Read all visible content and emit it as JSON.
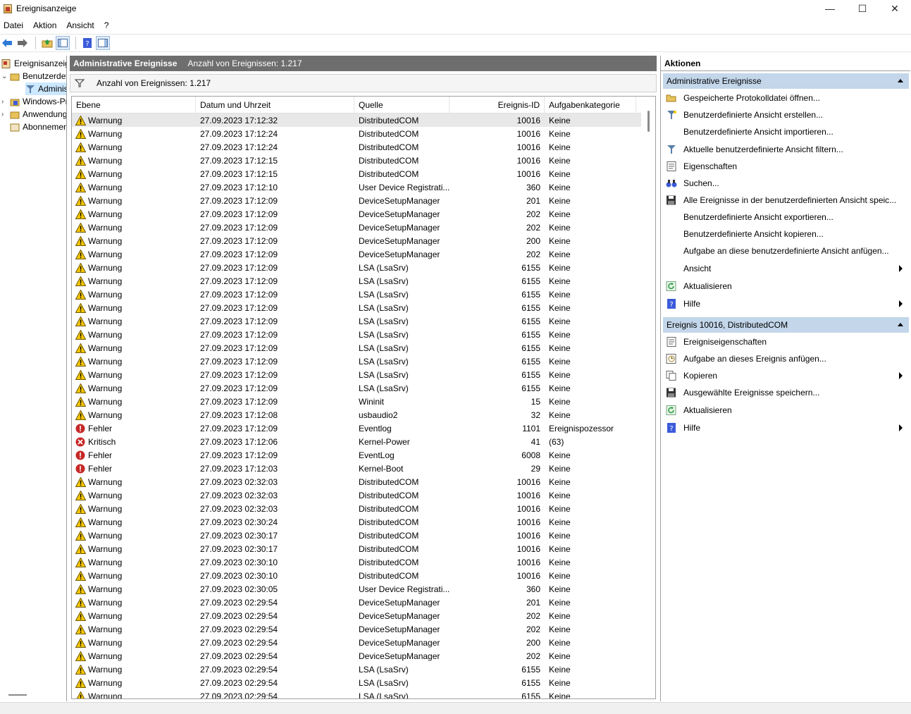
{
  "window": {
    "title": "Ereignisanzeige",
    "minimize_glyph": "—",
    "maximize_glyph": "☐",
    "close_glyph": "✕"
  },
  "menu": [
    "Datei",
    "Aktion",
    "Ansicht",
    "?"
  ],
  "tree": {
    "root": "Ereignisanzeige (Lokal)",
    "custom_views": "Benutzerdefinierte Ansichten",
    "admin_events": "Administrative Ereignisse",
    "windows_logs": "Windows-Protokolle",
    "app_logs": "Anwendungs- und Dienstprotokolle",
    "subscriptions": "Abonnements"
  },
  "center": {
    "header_title": "Administrative Ereignisse",
    "header_count": "Anzahl von Ereignissen: 1.217",
    "filter_text": "Anzahl von Ereignissen: 1.217",
    "columns": [
      "Ebene",
      "Datum und Uhrzeit",
      "Quelle",
      "Ereignis-ID",
      "Aufgabenkategorie"
    ],
    "rows": [
      [
        "Warnung",
        "27.09.2023 17:12:32",
        "DistributedCOM",
        "10016",
        "Keine"
      ],
      [
        "Warnung",
        "27.09.2023 17:12:24",
        "DistributedCOM",
        "10016",
        "Keine"
      ],
      [
        "Warnung",
        "27.09.2023 17:12:24",
        "DistributedCOM",
        "10016",
        "Keine"
      ],
      [
        "Warnung",
        "27.09.2023 17:12:15",
        "DistributedCOM",
        "10016",
        "Keine"
      ],
      [
        "Warnung",
        "27.09.2023 17:12:15",
        "DistributedCOM",
        "10016",
        "Keine"
      ],
      [
        "Warnung",
        "27.09.2023 17:12:10",
        "User Device Registrati...",
        "360",
        "Keine"
      ],
      [
        "Warnung",
        "27.09.2023 17:12:09",
        "DeviceSetupManager",
        "201",
        "Keine"
      ],
      [
        "Warnung",
        "27.09.2023 17:12:09",
        "DeviceSetupManager",
        "202",
        "Keine"
      ],
      [
        "Warnung",
        "27.09.2023 17:12:09",
        "DeviceSetupManager",
        "202",
        "Keine"
      ],
      [
        "Warnung",
        "27.09.2023 17:12:09",
        "DeviceSetupManager",
        "200",
        "Keine"
      ],
      [
        "Warnung",
        "27.09.2023 17:12:09",
        "DeviceSetupManager",
        "202",
        "Keine"
      ],
      [
        "Warnung",
        "27.09.2023 17:12:09",
        "LSA (LsaSrv)",
        "6155",
        "Keine"
      ],
      [
        "Warnung",
        "27.09.2023 17:12:09",
        "LSA (LsaSrv)",
        "6155",
        "Keine"
      ],
      [
        "Warnung",
        "27.09.2023 17:12:09",
        "LSA (LsaSrv)",
        "6155",
        "Keine"
      ],
      [
        "Warnung",
        "27.09.2023 17:12:09",
        "LSA (LsaSrv)",
        "6155",
        "Keine"
      ],
      [
        "Warnung",
        "27.09.2023 17:12:09",
        "LSA (LsaSrv)",
        "6155",
        "Keine"
      ],
      [
        "Warnung",
        "27.09.2023 17:12:09",
        "LSA (LsaSrv)",
        "6155",
        "Keine"
      ],
      [
        "Warnung",
        "27.09.2023 17:12:09",
        "LSA (LsaSrv)",
        "6155",
        "Keine"
      ],
      [
        "Warnung",
        "27.09.2023 17:12:09",
        "LSA (LsaSrv)",
        "6155",
        "Keine"
      ],
      [
        "Warnung",
        "27.09.2023 17:12:09",
        "LSA (LsaSrv)",
        "6155",
        "Keine"
      ],
      [
        "Warnung",
        "27.09.2023 17:12:09",
        "LSA (LsaSrv)",
        "6155",
        "Keine"
      ],
      [
        "Warnung",
        "27.09.2023 17:12:09",
        "Wininit",
        "15",
        "Keine"
      ],
      [
        "Warnung",
        "27.09.2023 17:12:08",
        "usbaudio2",
        "32",
        "Keine"
      ],
      [
        "Fehler",
        "27.09.2023 17:12:09",
        "Eventlog",
        "1101",
        "Ereignispozessor"
      ],
      [
        "Kritisch",
        "27.09.2023 17:12:06",
        "Kernel-Power",
        "41",
        "(63)"
      ],
      [
        "Fehler",
        "27.09.2023 17:12:09",
        "EventLog",
        "6008",
        "Keine"
      ],
      [
        "Fehler",
        "27.09.2023 17:12:03",
        "Kernel-Boot",
        "29",
        "Keine"
      ],
      [
        "Warnung",
        "27.09.2023 02:32:03",
        "DistributedCOM",
        "10016",
        "Keine"
      ],
      [
        "Warnung",
        "27.09.2023 02:32:03",
        "DistributedCOM",
        "10016",
        "Keine"
      ],
      [
        "Warnung",
        "27.09.2023 02:32:03",
        "DistributedCOM",
        "10016",
        "Keine"
      ],
      [
        "Warnung",
        "27.09.2023 02:30:24",
        "DistributedCOM",
        "10016",
        "Keine"
      ],
      [
        "Warnung",
        "27.09.2023 02:30:17",
        "DistributedCOM",
        "10016",
        "Keine"
      ],
      [
        "Warnung",
        "27.09.2023 02:30:17",
        "DistributedCOM",
        "10016",
        "Keine"
      ],
      [
        "Warnung",
        "27.09.2023 02:30:10",
        "DistributedCOM",
        "10016",
        "Keine"
      ],
      [
        "Warnung",
        "27.09.2023 02:30:10",
        "DistributedCOM",
        "10016",
        "Keine"
      ],
      [
        "Warnung",
        "27.09.2023 02:30:05",
        "User Device Registrati...",
        "360",
        "Keine"
      ],
      [
        "Warnung",
        "27.09.2023 02:29:54",
        "DeviceSetupManager",
        "201",
        "Keine"
      ],
      [
        "Warnung",
        "27.09.2023 02:29:54",
        "DeviceSetupManager",
        "202",
        "Keine"
      ],
      [
        "Warnung",
        "27.09.2023 02:29:54",
        "DeviceSetupManager",
        "202",
        "Keine"
      ],
      [
        "Warnung",
        "27.09.2023 02:29:54",
        "DeviceSetupManager",
        "200",
        "Keine"
      ],
      [
        "Warnung",
        "27.09.2023 02:29:54",
        "DeviceSetupManager",
        "202",
        "Keine"
      ],
      [
        "Warnung",
        "27.09.2023 02:29:54",
        "LSA (LsaSrv)",
        "6155",
        "Keine"
      ],
      [
        "Warnung",
        "27.09.2023 02:29:54",
        "LSA (LsaSrv)",
        "6155",
        "Keine"
      ],
      [
        "Warnung",
        "27.09.2023 02:29:54",
        "LSA (LsaSrv)",
        "6155",
        "Keine"
      ]
    ],
    "level_icons": {
      "Warnung": "warning-icon",
      "Fehler": "error-icon",
      "Kritisch": "critical-icon"
    }
  },
  "actions": {
    "title": "Aktionen",
    "section1_title": "Administrative Ereignisse",
    "section1": [
      {
        "label": "Gespeicherte Protokolldatei öffnen...",
        "icon": "folder-open-icon",
        "submenu": false
      },
      {
        "label": "Benutzerdefinierte Ansicht erstellen...",
        "icon": "filter-create-icon",
        "submenu": false
      },
      {
        "label": "Benutzerdefinierte Ansicht importieren...",
        "icon": "",
        "submenu": false
      },
      {
        "label": "Aktuelle benutzerdefinierte Ansicht filtern...",
        "icon": "filter-icon",
        "submenu": false
      },
      {
        "label": "Eigenschaften",
        "icon": "properties-icon",
        "submenu": false
      },
      {
        "label": "Suchen...",
        "icon": "binoculars-icon",
        "submenu": false
      },
      {
        "label": "Alle Ereignisse in der benutzerdefinierten Ansicht speic...",
        "icon": "save-icon",
        "submenu": false
      },
      {
        "label": "Benutzerdefinierte Ansicht exportieren...",
        "icon": "",
        "submenu": false
      },
      {
        "label": "Benutzerdefinierte Ansicht kopieren...",
        "icon": "",
        "submenu": false
      },
      {
        "label": "Aufgabe an diese benutzerdefinierte Ansicht anfügen...",
        "icon": "",
        "submenu": false
      },
      {
        "label": "Ansicht",
        "icon": "",
        "submenu": true
      },
      {
        "label": "Aktualisieren",
        "icon": "refresh-icon",
        "submenu": false
      },
      {
        "label": "Hilfe",
        "icon": "help-icon",
        "submenu": true
      }
    ],
    "section2_title": "Ereignis 10016, DistributedCOM",
    "section2": [
      {
        "label": "Ereigniseigenschaften",
        "icon": "properties-icon",
        "submenu": false
      },
      {
        "label": "Aufgabe an dieses Ereignis anfügen...",
        "icon": "task-icon",
        "submenu": false
      },
      {
        "label": "Kopieren",
        "icon": "copy-icon",
        "submenu": true
      },
      {
        "label": "Ausgewählte Ereignisse speichern...",
        "icon": "save-icon",
        "submenu": false
      },
      {
        "label": "Aktualisieren",
        "icon": "refresh-icon",
        "submenu": false
      },
      {
        "label": "Hilfe",
        "icon": "help-icon",
        "submenu": true
      }
    ]
  }
}
